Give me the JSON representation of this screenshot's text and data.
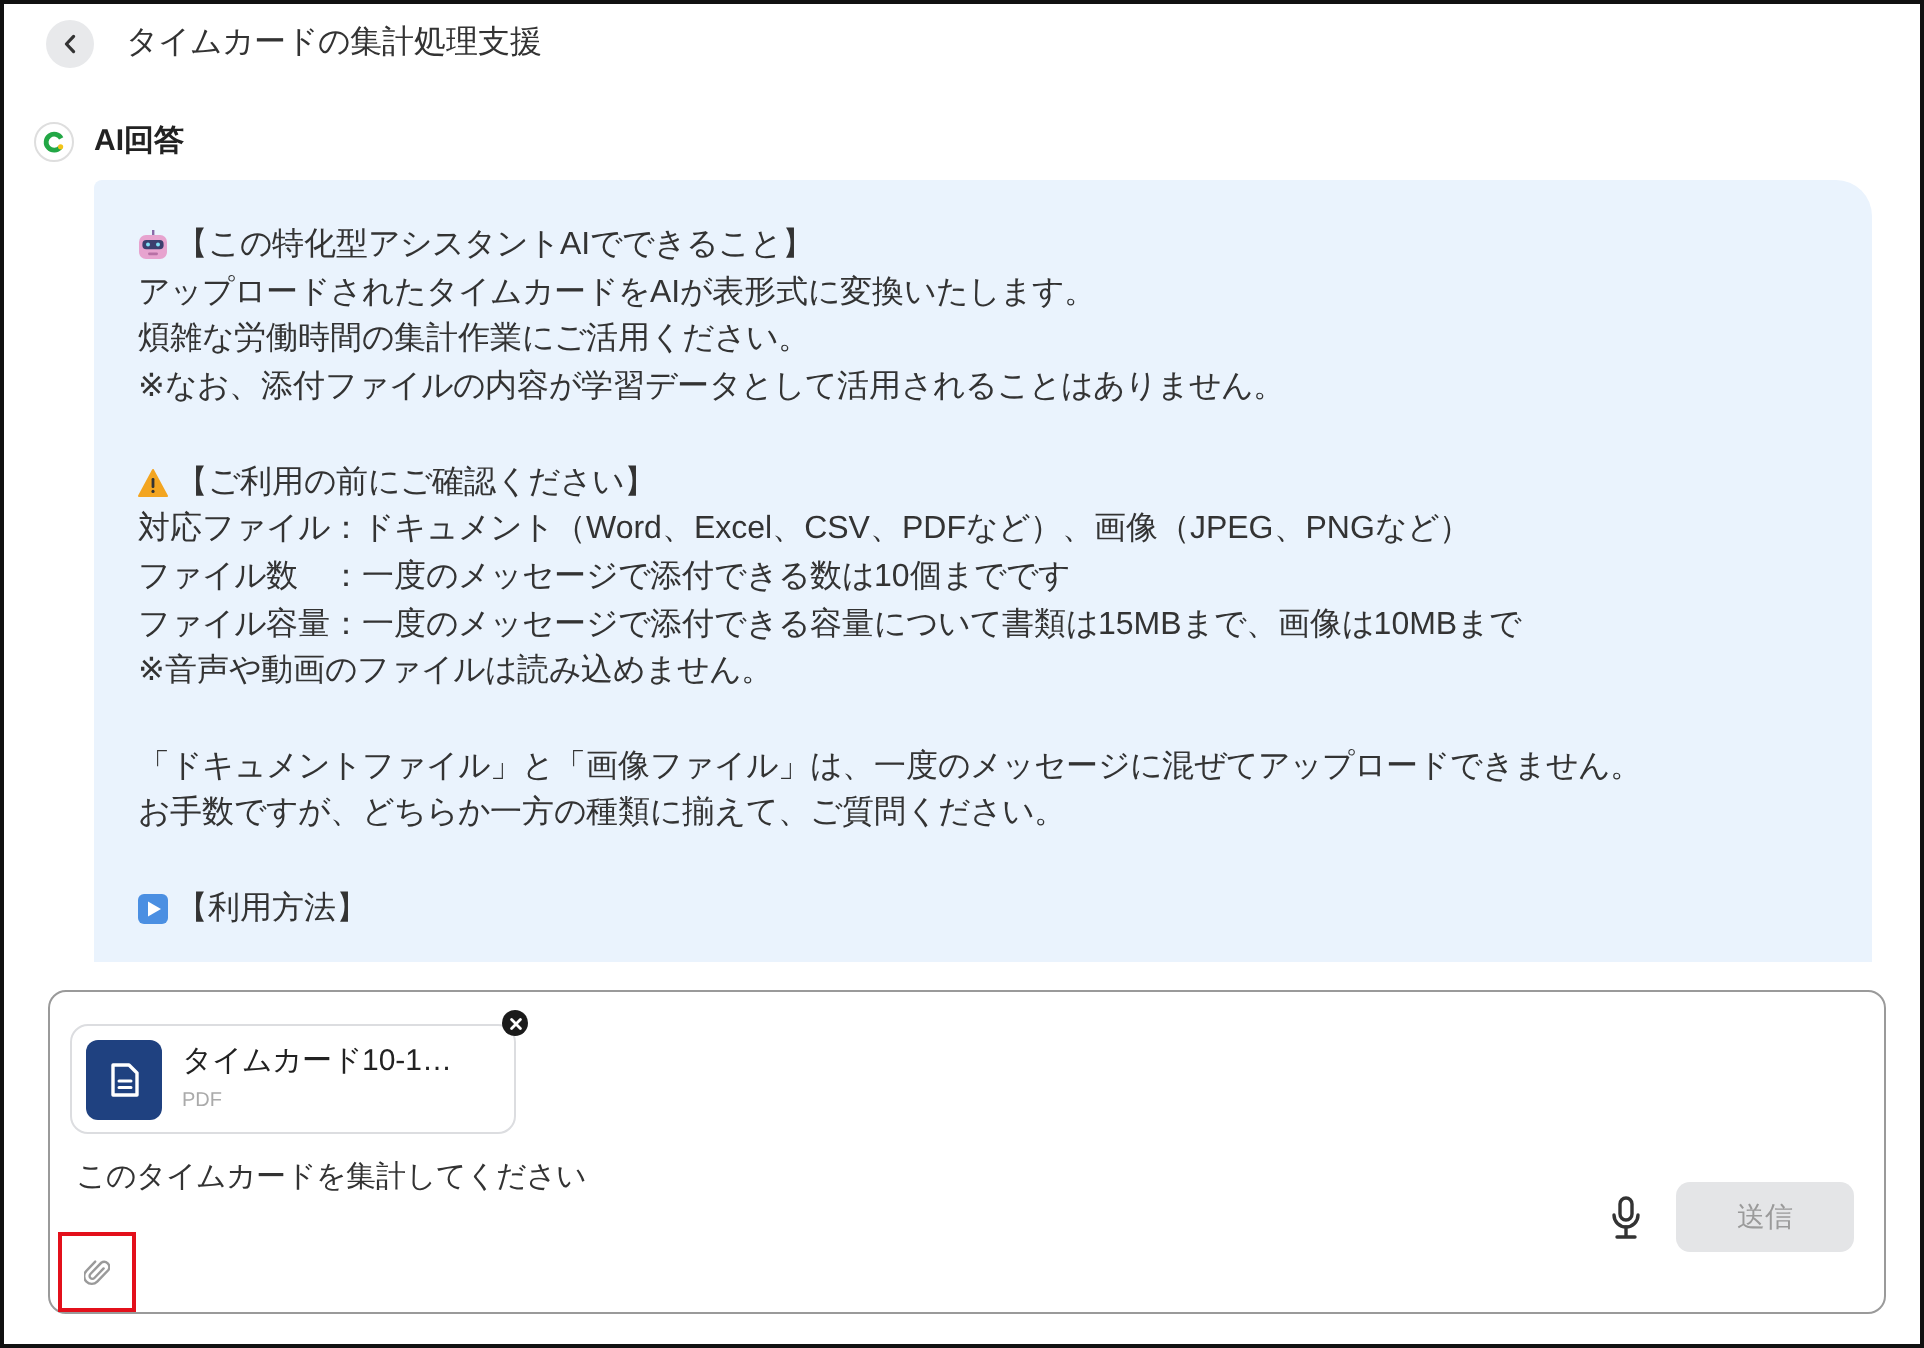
{
  "header": {
    "title": "タイムカードの集計処理支援"
  },
  "assistant": {
    "label": "AI回答"
  },
  "message": {
    "sections": [
      {
        "heading": "【この特化型アシスタントAIでできること】",
        "paragraphs": [
          [
            "アップロードされたタイムカードをAIが表形式に変換いたします。",
            "煩雑な労働時間の集計作業にご活用ください。",
            "※なお、添付ファイルの内容が学習データとして活用されることはありません。"
          ]
        ]
      },
      {
        "heading": "【ご利用の前にご確認ください】",
        "paragraphs": [
          [
            "対応ファイル：ドキュメント（Word、Excel、CSV、PDFなど）、画像（JPEG、PNGなど）",
            "ファイル数　：一度のメッセージで添付できる数は10個までです",
            "ファイル容量：一度のメッセージで添付できる容量について書類は15MBまで、画像は10MBまで",
            "※音声や動画のファイルは読み込めません。"
          ],
          [
            "「ドキュメントファイル」と「画像ファイル」は、一度のメッセージに混ぜてアップロードできません。",
            "お手数ですが、どちらか一方の種類に揃えて、ご質問ください。"
          ]
        ]
      },
      {
        "heading": "【利用方法】"
      }
    ]
  },
  "composer": {
    "attachments": [
      {
        "name": "タイムカード10-1…",
        "type": "PDF"
      }
    ],
    "value": "このタイムカードを集計してください",
    "attach_button": {
      "highlighted": true
    },
    "send_button": {
      "label": "送信",
      "disabled": true
    }
  }
}
